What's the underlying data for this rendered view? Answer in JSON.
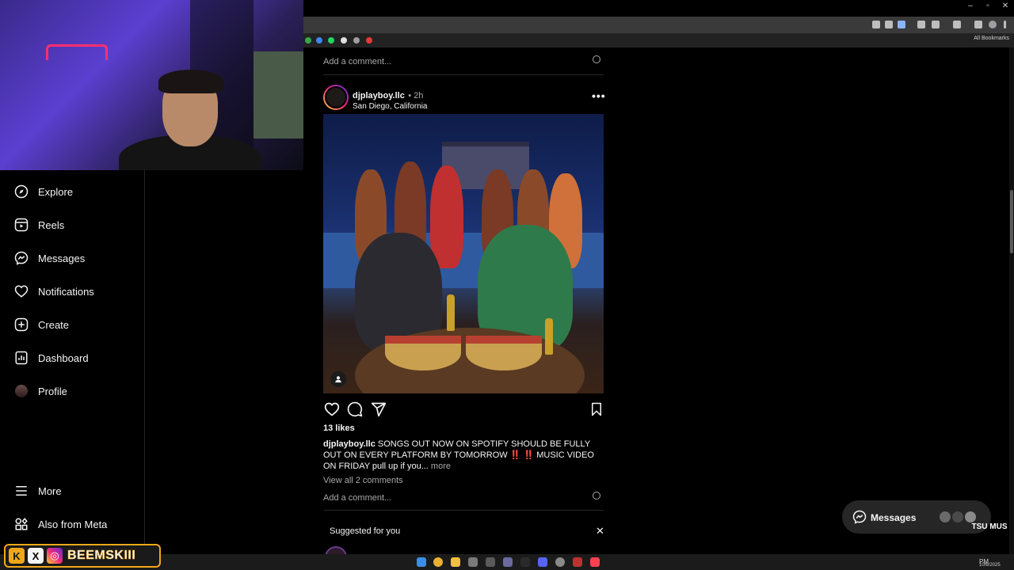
{
  "browser": {
    "bookmarks_label": "All Bookmarks",
    "window_controls": [
      "–",
      "▫",
      "✕"
    ]
  },
  "sidebar": {
    "items": [
      {
        "label": "Explore",
        "icon": "compass-icon"
      },
      {
        "label": "Reels",
        "icon": "reels-icon"
      },
      {
        "label": "Messages",
        "icon": "messenger-icon"
      },
      {
        "label": "Notifications",
        "icon": "heart-icon"
      },
      {
        "label": "Create",
        "icon": "plus-square-icon"
      },
      {
        "label": "Dashboard",
        "icon": "dashboard-icon"
      },
      {
        "label": "Profile",
        "icon": "avatar"
      }
    ],
    "bottom_items": [
      {
        "label": "More",
        "icon": "menu-icon"
      },
      {
        "label": "Also from Meta",
        "icon": "meta-apps-icon"
      }
    ]
  },
  "feed": {
    "top_add_comment": "Add a comment...",
    "post": {
      "username": "djplayboy.llc",
      "time": "• 2h",
      "location": "San Diego, California",
      "more_dots": "•••",
      "likes": "13 likes",
      "caption_user": "djplayboy.llc",
      "caption_text": " SONGS OUT NOW ON SPOTIFY SHOULD BE FULLY OUT ON EVERY PLATFORM BY TOMORROW ‼️ ‼️ MUSIC VIDEO ON FRIDAY pull up if you...",
      "caption_more": " more",
      "view_comments": "View all 2 comments",
      "add_comment": "Add a comment..."
    },
    "suggested": {
      "title": "Suggested for you",
      "close": "✕"
    }
  },
  "messages_pill": {
    "label": "Messages"
  },
  "overlay": {
    "streamer_name": "BEEMSKIII",
    "k_badge": "K",
    "x_badge": "X",
    "ig_badge": "◎",
    "corner_logo": "TSU MUS"
  },
  "taskbar": {
    "time": "PM",
    "date": "10/8/2025"
  },
  "colors": {
    "background": "#000000",
    "text": "#f5f5f5",
    "muted": "#a8a8a8",
    "divider": "#262626",
    "overlay_accent": "#f0a818"
  }
}
